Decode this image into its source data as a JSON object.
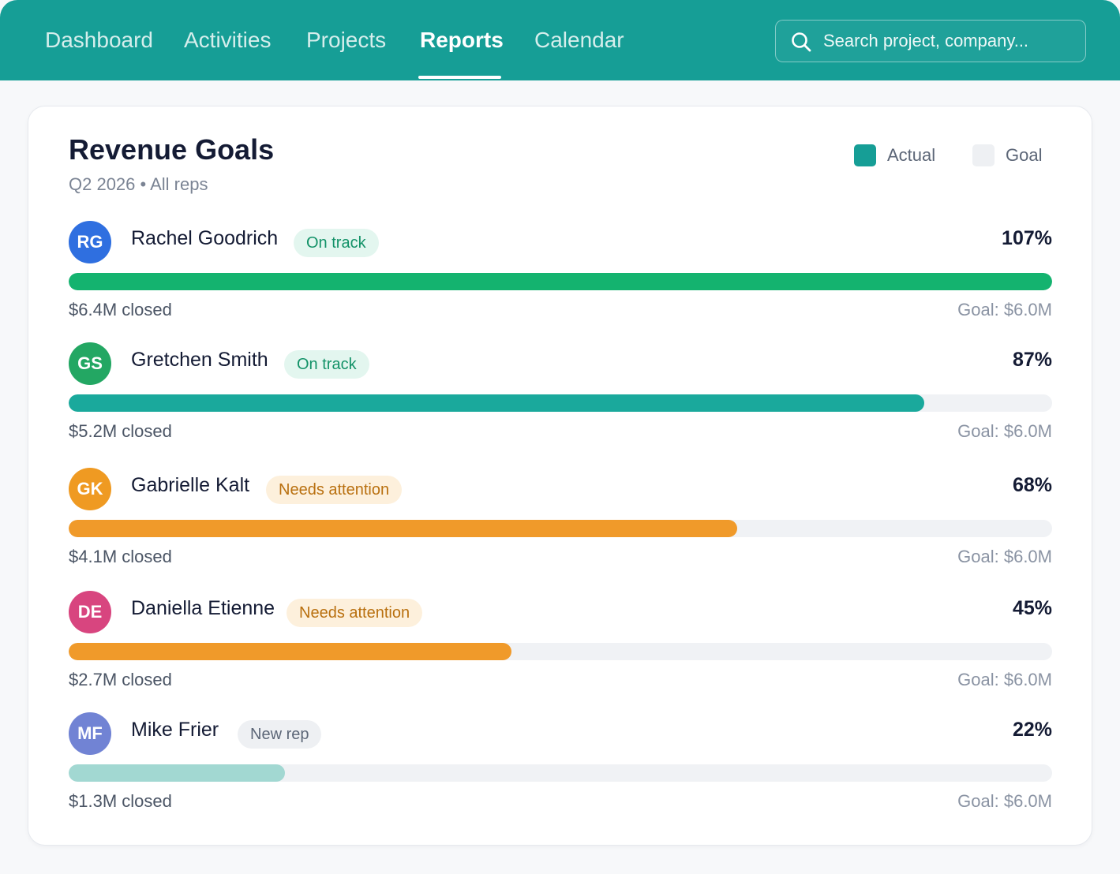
{
  "nav": {
    "items": [
      {
        "label": "Dashboard",
        "active": false
      },
      {
        "label": "Activities",
        "active": false
      },
      {
        "label": "Projects",
        "active": false
      },
      {
        "label": "Reports",
        "active": true
      },
      {
        "label": "Calendar",
        "active": false
      }
    ]
  },
  "search": {
    "placeholder": "Search project, company..."
  },
  "card": {
    "title": "Revenue Goals",
    "subtitle": "Q2 2026 • All reps",
    "legend": {
      "actual": {
        "label": "Actual",
        "color": "#169e96"
      },
      "goal": {
        "label": "Goal",
        "color": "#f0f2f5"
      }
    }
  },
  "reps": [
    {
      "initials": "RG",
      "name": "Rachel Goodrich",
      "status": "On track",
      "status_type": "ontrack",
      "percent_label": "107%",
      "progress": 1.0,
      "closed": "$6.4M closed",
      "goal": "Goal: $6.0M",
      "avatar_color": "#2f6fe0",
      "bar_color": "#14b36f"
    },
    {
      "initials": "GS",
      "name": "Gretchen Smith",
      "status": "On track",
      "status_type": "ontrack",
      "percent_label": "87%",
      "progress": 0.87,
      "closed": "$5.2M closed",
      "goal": "Goal: $6.0M",
      "avatar_color": "#23a763",
      "bar_color": "#1aa99c"
    },
    {
      "initials": "GK",
      "name": "Gabrielle Kalt",
      "status": "Needs attention",
      "status_type": "attention",
      "percent_label": "68%",
      "progress": 0.68,
      "closed": "$4.1M closed",
      "goal": "Goal: $6.0M",
      "avatar_color": "#ef9a22",
      "bar_color": "#f09a2a"
    },
    {
      "initials": "DE",
      "name": "Daniella Etienne",
      "status": "Needs attention",
      "status_type": "attention",
      "percent_label": "45%",
      "progress": 0.45,
      "closed": "$2.7M closed",
      "goal": "Goal: $6.0M",
      "avatar_color": "#d8457f",
      "bar_color": "#f09a2a"
    },
    {
      "initials": "MF",
      "name": "Mike Frier",
      "status": "New rep",
      "status_type": "newrep",
      "percent_label": "22%",
      "progress": 0.22,
      "closed": "$1.3M closed",
      "goal": "Goal: $6.0M",
      "avatar_color": "#7183d4",
      "bar_color": "#a2d8d2"
    }
  ]
}
